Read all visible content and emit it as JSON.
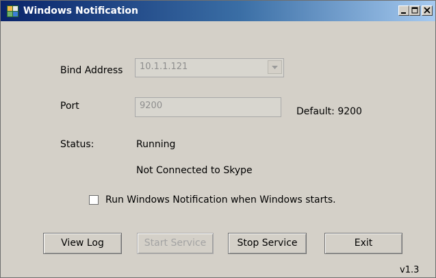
{
  "window": {
    "title": "Windows Notification",
    "title_gradient": [
      "#0a246a",
      "#3a6ea5",
      "#a6caf0"
    ],
    "controls": [
      "minimize-icon",
      "maximize-icon",
      "close-icon"
    ]
  },
  "form": {
    "bind_address_label": "Bind Address",
    "bind_address_value": "10.1.1.121",
    "port_label": "Port",
    "port_value": "9200",
    "port_default": "Default: 9200",
    "status_label": "Status:",
    "status_value": "Running",
    "status_detail": "Not Connected to Skype",
    "startup_checkbox_label": "Run Windows Notification when Windows starts.",
    "startup_checked": false
  },
  "buttons": {
    "view_log": "View Log",
    "start_service": "Start Service",
    "stop_service": "Stop Service",
    "exit": "Exit"
  },
  "version": "v1.3"
}
